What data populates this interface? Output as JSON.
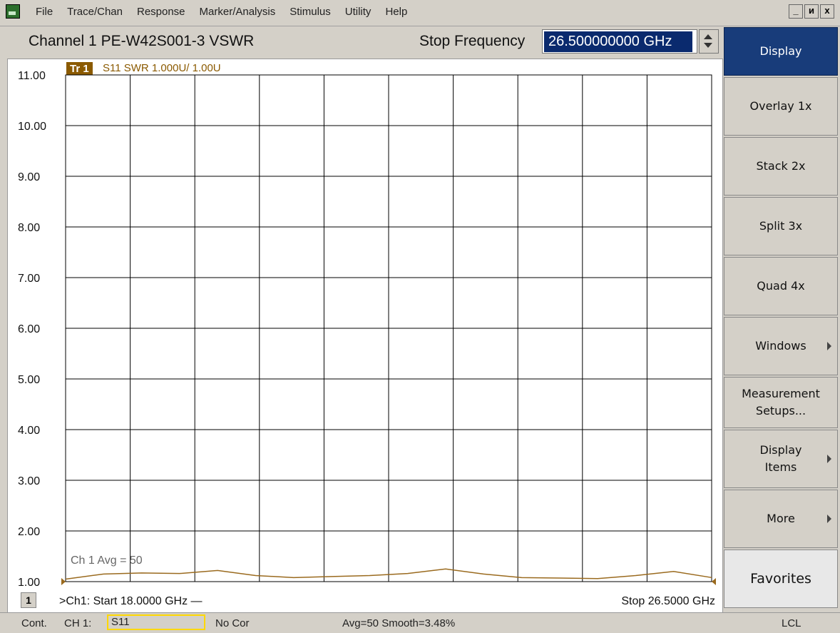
{
  "menu": {
    "items": [
      "File",
      "Trace/Chan",
      "Response",
      "Marker/Analysis",
      "Stimulus",
      "Utility",
      "Help"
    ]
  },
  "window_controls": [
    "_",
    "и",
    "x"
  ],
  "channel": {
    "title": "Channel 1  PE-W42S001-3 VSWR",
    "stop_label": "Stop Frequency",
    "stop_value": "26.500000000 GHz"
  },
  "trace": {
    "tag": "Tr  1",
    "desc": "S11 SWR 1.000U/  1.00U",
    "color": "#9a6a1e"
  },
  "plot": {
    "avg_text": "Ch 1 Avg =    50",
    "footer_num": "1",
    "start_text": ">Ch1: Start  18.0000 GHz —",
    "stop_text": "Stop  26.5000 GHz"
  },
  "softkeys": [
    {
      "label": "Display",
      "active": true
    },
    {
      "label": "Overlay 1x"
    },
    {
      "label": "Stack 2x"
    },
    {
      "label": "Split 3x"
    },
    {
      "label": "Quad 4x"
    },
    {
      "label": "Windows",
      "arrow": true
    },
    {
      "label": "Measurement\nSetups..."
    },
    {
      "label": "Display\nItems",
      "arrow": true
    },
    {
      "label": "More",
      "arrow": true
    },
    {
      "label": "Favorites"
    }
  ],
  "status": {
    "mode": "Cont.",
    "channel": "CH 1:",
    "measurement": "S11",
    "correction": "No Cor",
    "avg_smooth": "Avg=50 Smooth=3.48%",
    "remote": "LCL"
  },
  "chart_data": {
    "type": "line",
    "title": "",
    "xlabel": "",
    "ylabel": "",
    "x_unit": "GHz",
    "xlim": [
      18.0,
      26.5
    ],
    "ylim": [
      1.0,
      11.0
    ],
    "yticks": [
      "11.00",
      "10.00",
      "9.00",
      "8.00",
      "7.00",
      "6.00",
      "5.00",
      "4.00",
      "3.00",
      "2.00",
      "1.00"
    ],
    "grid": true,
    "series": [
      {
        "x": [
          18.0,
          18.5,
          19.0,
          19.5,
          20.0,
          20.5,
          21.0,
          21.5,
          22.0,
          22.5,
          23.0,
          23.5,
          24.0,
          24.5,
          25.0,
          25.5,
          26.0,
          26.5
        ],
        "values": [
          1.05,
          1.15,
          1.17,
          1.16,
          1.22,
          1.12,
          1.08,
          1.1,
          1.12,
          1.16,
          1.25,
          1.15,
          1.08,
          1.07,
          1.06,
          1.12,
          1.2,
          1.08
        ]
      }
    ]
  }
}
